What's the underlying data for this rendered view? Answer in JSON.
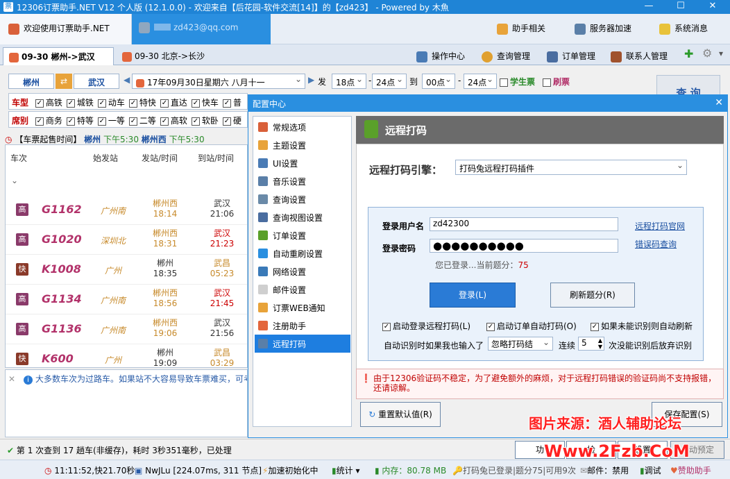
{
  "window": {
    "title": "12306订票助手.NET V12 个人版 (12.1.0.0) - 欢迎来自【后花园-软件交流[14]】的【zd423】 - Powered by 木魚"
  },
  "topbar": {
    "welcome": "欢迎使用订票助手.NET",
    "user_email": "zd423@qq.com",
    "helper": "助手相关",
    "server_accel": "服务器加速",
    "sys_msg": "系统消息"
  },
  "tabs": [
    {
      "label": "09-30  郴州->武汉"
    },
    {
      "label": "09-30  北京->长沙"
    }
  ],
  "menu": {
    "ops": "操作中心",
    "query_mgr": "查询管理",
    "order_mgr": "订单管理",
    "contact_mgr": "联系人管理"
  },
  "search": {
    "from": "郴州",
    "to": "武汉",
    "date": "17年09月30日星期六 八月十一",
    "depart_label": "发",
    "t1": "18点",
    "t2": "24点",
    "to_label": "到",
    "t3": "00点",
    "t4": "24点",
    "student": "学生票",
    "refresh": "刷票",
    "query_btn": "查 询",
    "dash": "-"
  },
  "filters": {
    "type_label": "车型",
    "types": [
      "高铁",
      "城铁",
      "动车",
      "特快",
      "直达",
      "快车",
      "普"
    ],
    "seat_label": "席别",
    "seats": [
      "商务",
      "特等",
      "一等",
      "二等",
      "高软",
      "软卧",
      "硬"
    ]
  },
  "sale_info": {
    "prefix": "【车票起售时间】",
    "s1": "郴州",
    "t1": "下午5:30",
    "s2": "郴州西",
    "t2": "下午5:30"
  },
  "columns": [
    "车次",
    "始发站",
    "发站/时间",
    "到站/时间"
  ],
  "trains": [
    {
      "badge": "高",
      "no": "G1162",
      "origin": "广州南",
      "dep_st": "郴州西",
      "dep_t": "18:14",
      "arr_st": "武汉",
      "arr_t": "21:06"
    },
    {
      "badge": "高",
      "no": "G1020",
      "origin": "深圳北",
      "dep_st": "郴州西",
      "dep_t": "18:31",
      "arr_st": "武汉",
      "arr_t": "21:23"
    },
    {
      "badge": "快",
      "no": "K1008",
      "origin": "广州",
      "dep_st": "郴州",
      "dep_t": "18:35",
      "arr_st": "武昌",
      "arr_t": "05:23"
    },
    {
      "badge": "高",
      "no": "G1134",
      "origin": "广州南",
      "dep_st": "郴州西",
      "dep_t": "18:56",
      "arr_st": "武汉",
      "arr_t": "21:45"
    },
    {
      "badge": "高",
      "no": "G1136",
      "origin": "广州南",
      "dep_st": "郴州西",
      "dep_t": "19:06",
      "arr_st": "武汉",
      "arr_t": "21:56"
    },
    {
      "badge": "快",
      "no": "K600",
      "origin": "广州",
      "dep_st": "郴州",
      "dep_t": "19:09",
      "arr_st": "武昌",
      "arr_t": "03:29"
    }
  ],
  "notice": "大多数车次为过路车。如果站不大容易导致车票难买，可考",
  "dialog": {
    "title": "配置中心",
    "nav": [
      "常规选项",
      "主题设置",
      "UI设置",
      "音乐设置",
      "查询设置",
      "查询视图设置",
      "订单设置",
      "自动重刷设置",
      "网络设置",
      "邮件设置",
      "订票WEB通知",
      "注册助手",
      "远程打码"
    ],
    "panel_title": "远程打码",
    "engine_label": "远程打码引擎：",
    "engine_value": "打码兔远程打码插件",
    "user_label": "登录用户名",
    "user_value": "zd42300",
    "pwd_label": "登录密码",
    "pwd_value": "●●●●●●●●●●",
    "site_link": "远程打码官网",
    "err_link": "错误码查询",
    "status_text": "您已登录...当前题分：",
    "score": "75",
    "login_btn": "登录(L)",
    "refresh_btn": "刷新题分(R)",
    "opt1": "启动登录远程打码(L)",
    "opt2": "启动订单自动打码(O)",
    "opt3": "如果未能识别则自动刷新",
    "auto_prefix": "自动识别时如果我也输入了",
    "auto_select": "忽略打码结",
    "consec": "连续",
    "consec_val": "5",
    "auto_suffix": "次没能识别后放弃识别",
    "warning": "由于12306验证码不稳定，为了避免额外的麻烦，对于远程打码错误的验证码尚不支持报错，还请谅解。",
    "reset_btn": "重置默认值(R)",
    "save_btn": "保存配置(S)"
  },
  "status1": {
    "text": "第 1 次查到 17 趟车(非缓存)，耗时 3秒351毫秒，已处理",
    "b1": "功",
    "b2": "检",
    "b3": "设置",
    "b4": "自动预定"
  },
  "status2": {
    "clock": "11:11:52,快21.70秒",
    "net": "NwJLu [224.07ms, 311 节点]",
    "accel": "加速初始化中",
    "stats": "统计",
    "mem": "内存：80.78 MB",
    "captcha": "打码兔已登录|题分75|可用9次",
    "mail": "邮件：禁用",
    "debug": "调试",
    "sponsor": "赞助助手"
  },
  "watermark": {
    "line1": "图片来源：酒人辅助论坛",
    "line2": "Www.2Fzb.CoM"
  }
}
